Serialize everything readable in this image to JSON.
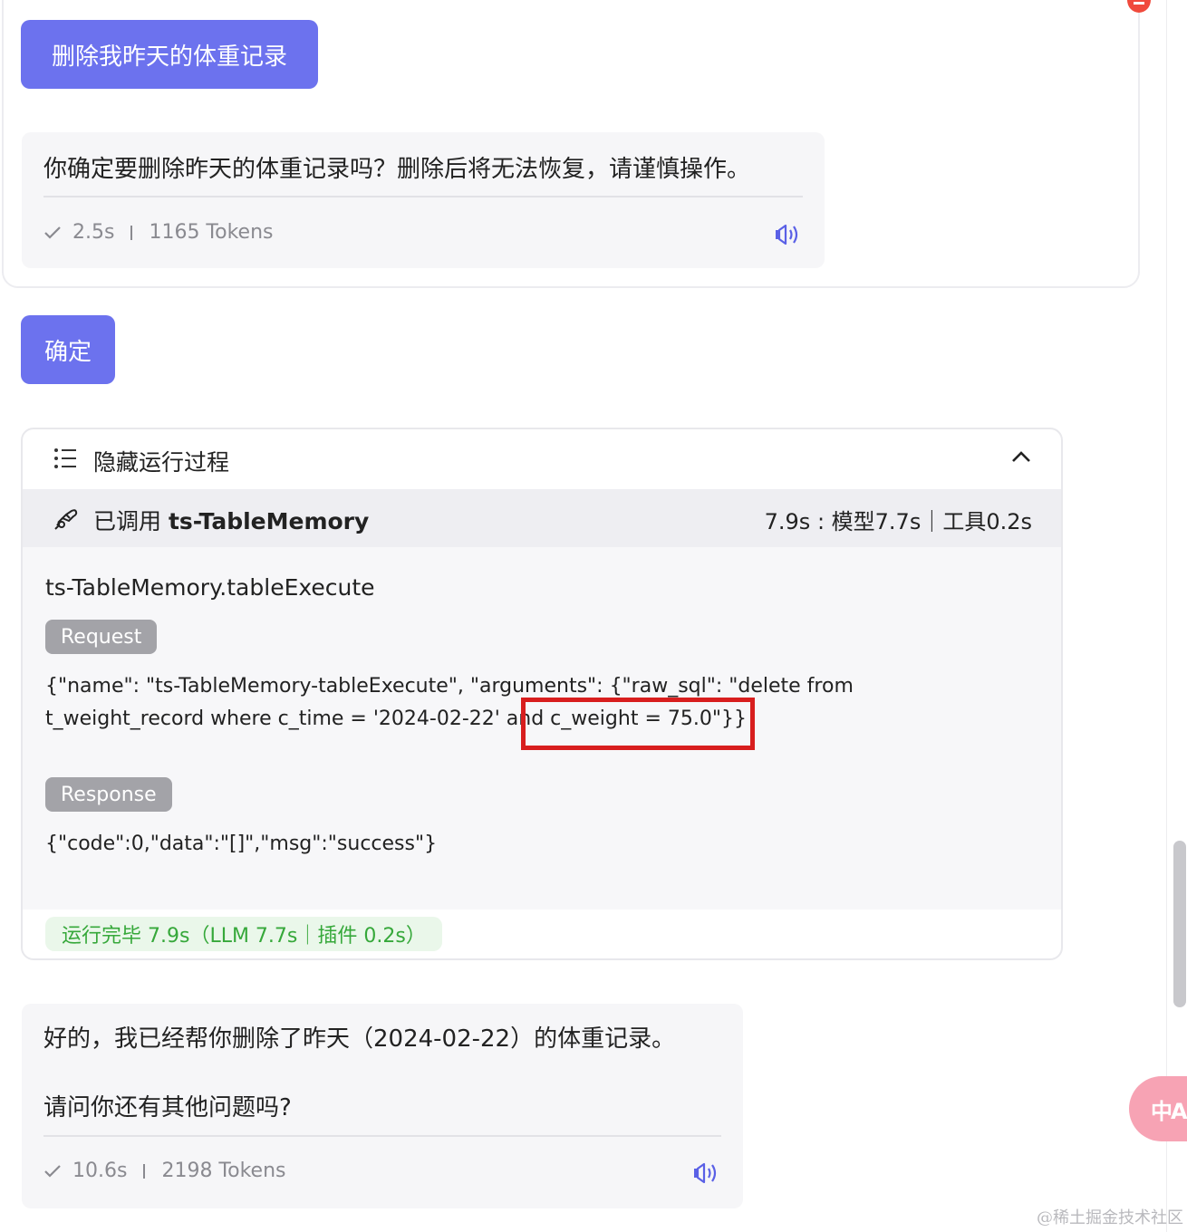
{
  "messages": {
    "user_1": "删除我昨天的体重记录",
    "assistant_1": {
      "text": "你确定要删除昨天的体重记录吗？删除后将无法恢复，请谨慎操作。",
      "duration": "2.5s",
      "tokens": "1165 Tokens"
    },
    "user_2": "确定",
    "assistant_2": {
      "line_1": "好的，我已经帮你删除了昨天（2024-02-22）的体重记录。",
      "line_2": "请问你还有其他问题吗?",
      "duration": "10.6s",
      "tokens": "2198 Tokens"
    }
  },
  "process": {
    "toggle_label": "隐藏运行过程",
    "tool_prefix": "已调用",
    "tool_name": "ts-TableMemory",
    "timing": "7.9s : 模型7.7s｜工具0.2s",
    "function_name": "ts-TableMemory.tableExecute",
    "request_tag": "Request",
    "request_line_1": "{\"name\": \"ts-TableMemory-tableExecute\", \"arguments\": {\"raw_sql\": \"delete from",
    "request_line_2": "t_weight_record where c_time = '2024-02-22' and c_weight = 75.0\"}}",
    "response_tag": "Response",
    "response_body": "{\"code\":0,\"data\":\"[]\",\"msg\":\"success\"}",
    "completion": "运行完毕 7.9s（LLM 7.7s｜插件 0.2s）"
  },
  "widgets": {
    "translate_glyph": "中A"
  },
  "watermark": "@稀土掘金技术社区",
  "colors": {
    "user_bubble": "#6c72ee",
    "success_green": "#36a83a",
    "annotation_red": "#d81e1e"
  }
}
